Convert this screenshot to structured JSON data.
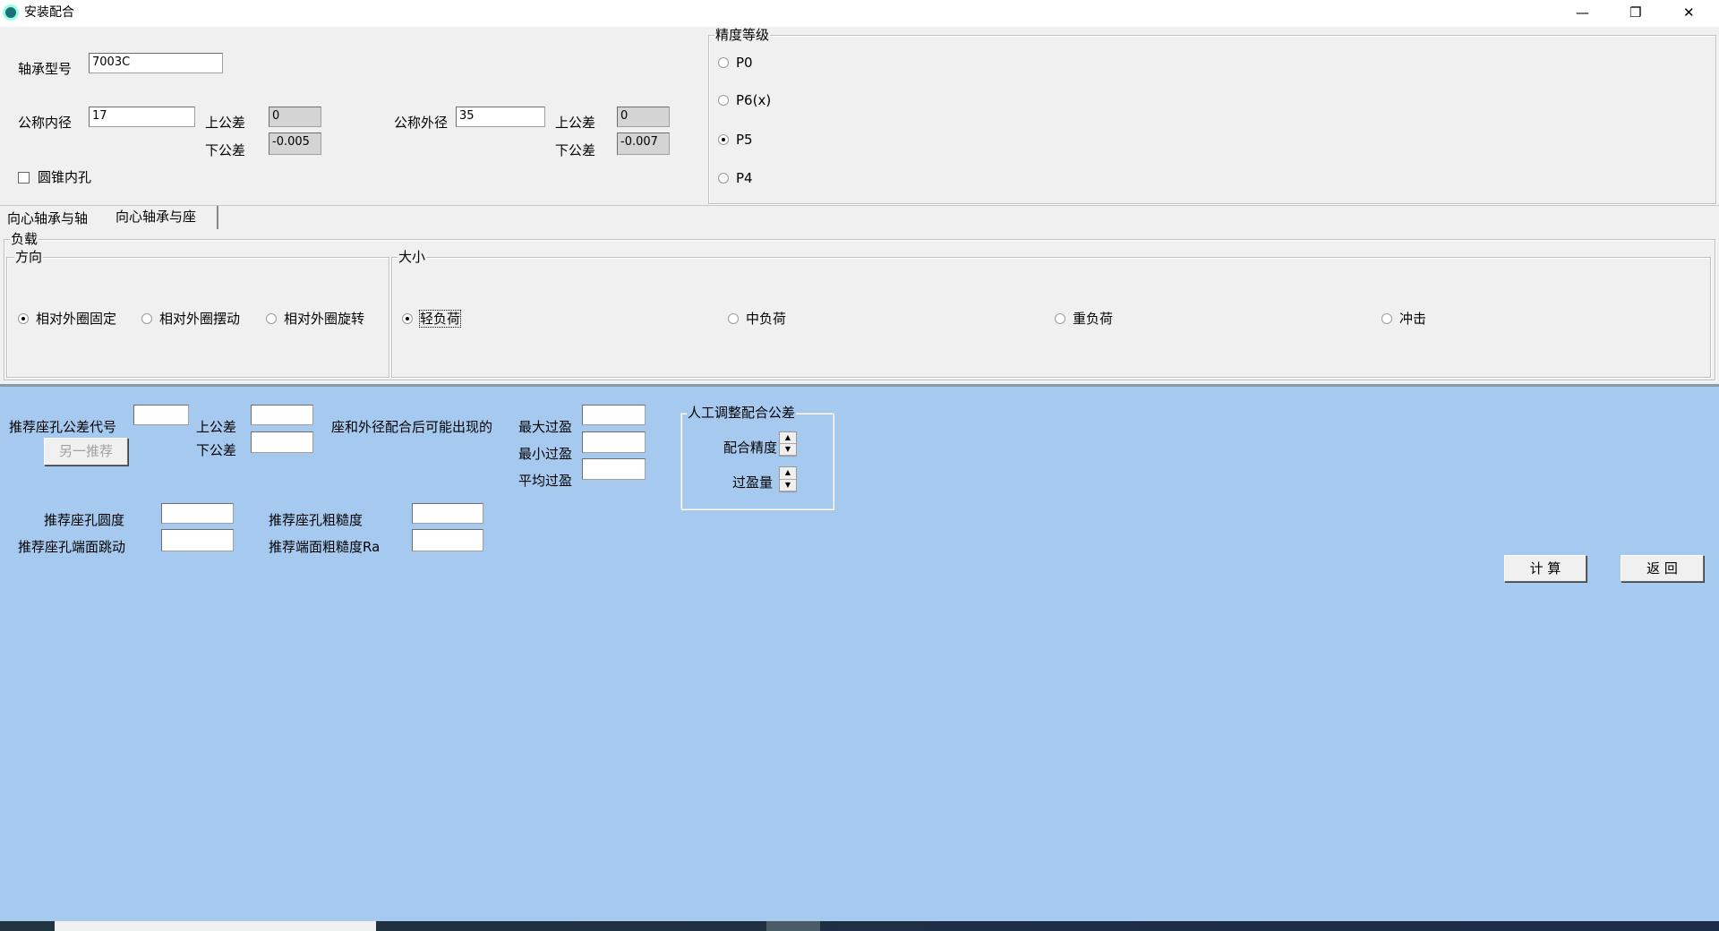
{
  "window": {
    "title": "安装配合",
    "minimize": "—",
    "restore": "❐",
    "close": "✕"
  },
  "bearing": {
    "model_label": "轴承型号",
    "model_value": "7003C",
    "inner_label": "公称内径",
    "inner_value": "17",
    "inner_upper_label": "上公差",
    "inner_upper": "0",
    "inner_lower_label": "下公差",
    "inner_lower": "-0.005",
    "outer_label": "公称外径",
    "outer_value": "35",
    "outer_upper_label": "上公差",
    "outer_upper": "0",
    "outer_lower_label": "下公差",
    "outer_lower": "-0.007",
    "taper_label": "圆锥内孔",
    "taper_checked": false
  },
  "precision": {
    "legend": "精度等级",
    "options": [
      "P0",
      "P6(x)",
      "P5",
      "P4"
    ],
    "selected": "P5"
  },
  "tabs": [
    {
      "label": "向心轴承与轴",
      "active": false
    },
    {
      "label": "向心轴承与座",
      "active": true
    }
  ],
  "load": {
    "legend": "负载",
    "direction": {
      "legend": "方向",
      "options": [
        "相对外圈固定",
        "相对外圈摆动",
        "相对外圈旋转"
      ],
      "selected": "相对外圈固定"
    },
    "size": {
      "legend": "大小",
      "options": [
        "轻负荷",
        "中负荷",
        "重负荷",
        "冲击"
      ],
      "selected": "轻负荷"
    }
  },
  "result": {
    "code_label": "推荐座孔公差代号",
    "upper_label": "上公差",
    "lower_label": "下公差",
    "another_button": "另一推荐",
    "fit_text": "座和外径配合后可能出现的",
    "max_label": "最大过盈",
    "min_label": "最小过盈",
    "avg_label": "平均过盈",
    "manual": {
      "legend": "人工调整配合公差",
      "precision_label": "配合精度",
      "interference_label": "过盈量"
    },
    "roundness_label": "推荐座孔圆度",
    "runout_label": "推荐座孔端面跳动",
    "roughness_label": "推荐座孔粗糙度",
    "end_roughness_label": "推荐端面粗糙度Ra"
  },
  "buttons": {
    "calc": "计 算",
    "back": "返 回"
  }
}
